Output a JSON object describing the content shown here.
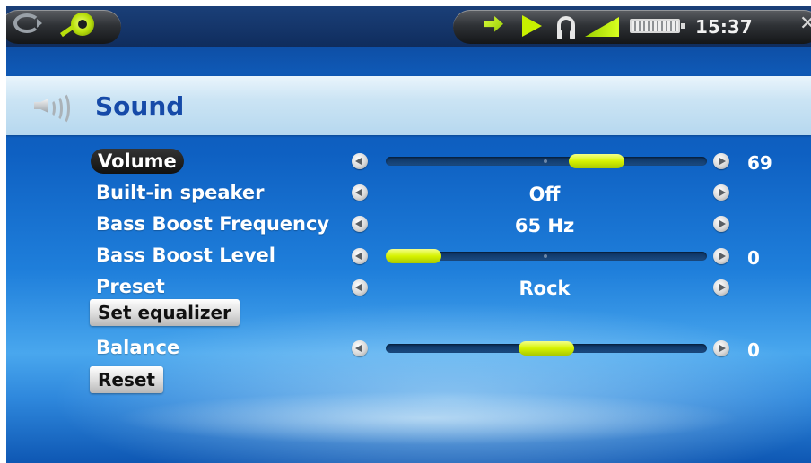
{
  "status_bar": {
    "time": "15:37",
    "icons": [
      "refresh-icon",
      "settings-icon",
      "arrows-icon",
      "play-icon",
      "headphones-icon",
      "signal-icon",
      "battery-icon",
      "close-icon"
    ]
  },
  "header": {
    "title": "Sound",
    "icon": "speaker-icon"
  },
  "settings": {
    "volume": {
      "label": "Volume",
      "value": "69",
      "level": 0.69
    },
    "builtin_speaker": {
      "label": "Built-in speaker",
      "value": "Off"
    },
    "bass_boost_frequency": {
      "label": "Bass Boost Frequency",
      "value": "65 Hz"
    },
    "bass_boost_level": {
      "label": "Bass Boost Level",
      "value": "0",
      "level": 0.0
    },
    "preset": {
      "label": "Preset",
      "value": "Rock"
    },
    "set_equalizer": {
      "label": "Set equalizer"
    },
    "balance": {
      "label": "Balance",
      "value": "0",
      "level": 0.5
    },
    "reset": {
      "label": "Reset"
    }
  },
  "colors": {
    "accent": "#d6f200",
    "title": "#164aa8",
    "background": "#0e60c2"
  }
}
